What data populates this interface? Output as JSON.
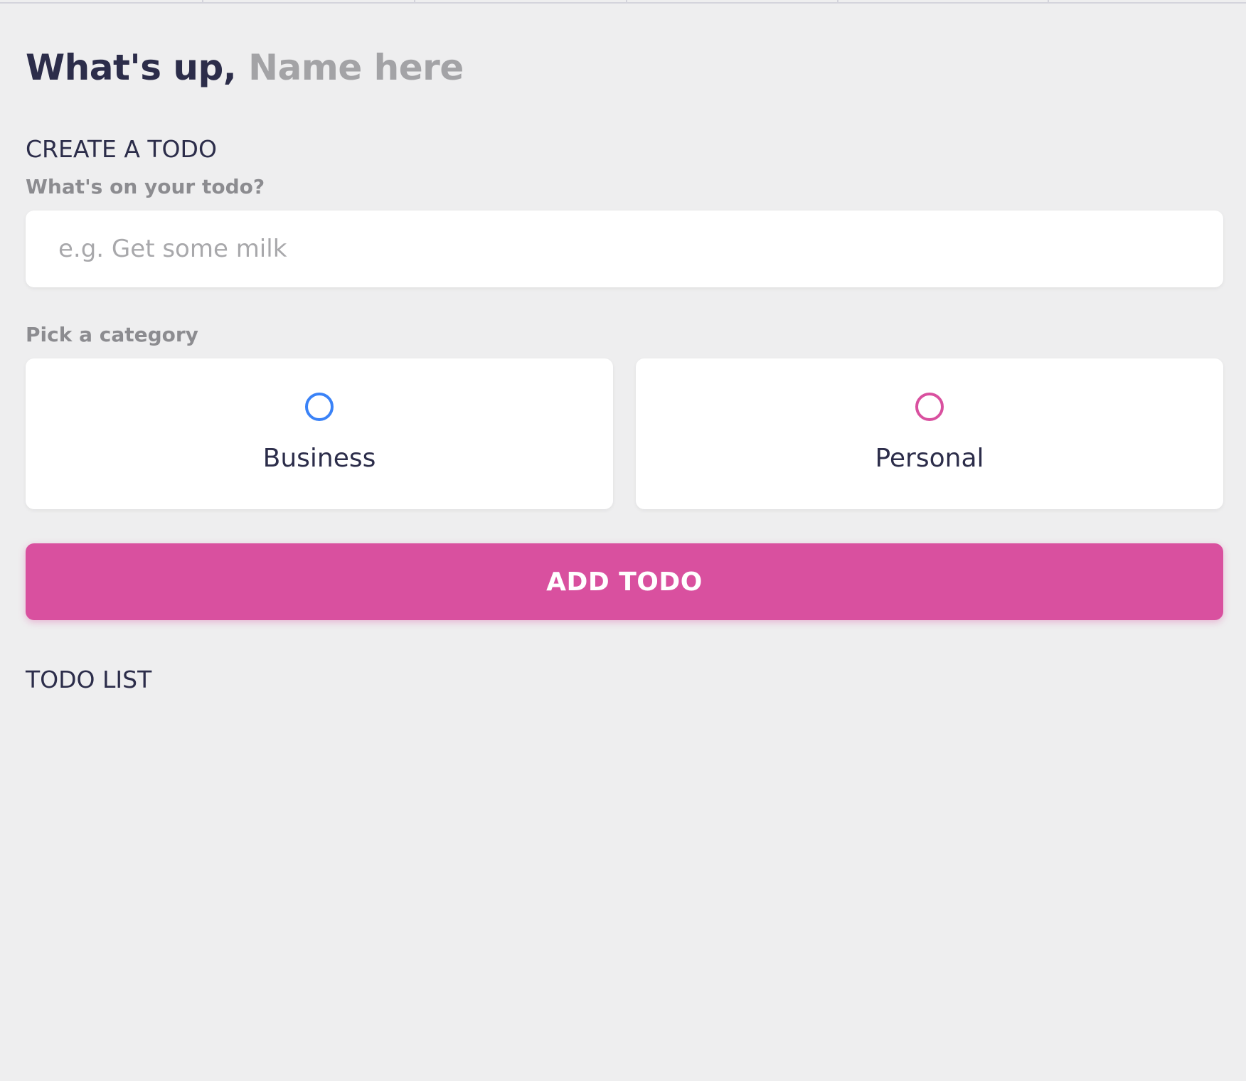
{
  "header": {
    "greeting_prefix": "What's up,",
    "name_placeholder": "Name here"
  },
  "create": {
    "section_title": "CREATE A TODO",
    "input_label": "What's on your todo?",
    "input_placeholder": "e.g. Get some milk",
    "input_value": "",
    "category_label": "Pick a category",
    "categories": [
      {
        "label": "Business",
        "color": "#3a82f7",
        "selected": false
      },
      {
        "label": "Personal",
        "color": "#d9509f",
        "selected": false
      }
    ],
    "add_button_label": "ADD TODO"
  },
  "list": {
    "section_title": "TODO LIST",
    "items": []
  },
  "colors": {
    "accent": "#d9509f",
    "business": "#3a82f7",
    "text": "#2c2d4a",
    "muted": "#8c8c90",
    "background": "#eeeeef"
  }
}
